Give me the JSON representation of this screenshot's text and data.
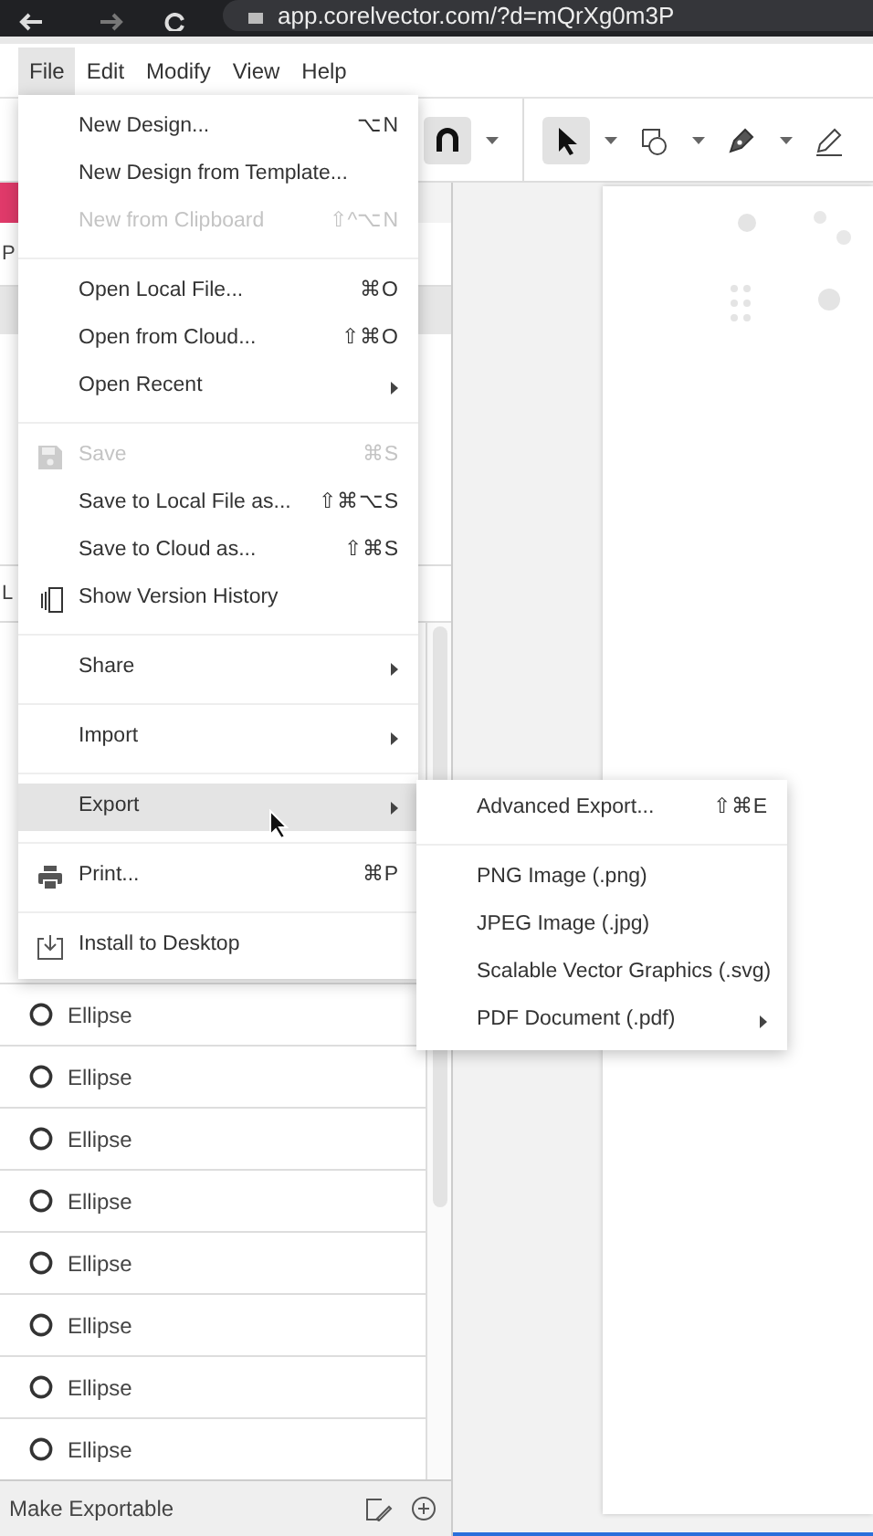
{
  "browser": {
    "url": "app.corelvector.com/?d=mQrXg0m3P"
  },
  "menubar": [
    {
      "label": "File",
      "selected": true
    },
    {
      "label": "Edit",
      "selected": false
    },
    {
      "label": "Modify",
      "selected": false
    },
    {
      "label": "View",
      "selected": false
    },
    {
      "label": "Help",
      "selected": false
    }
  ],
  "toolbar": [
    {
      "kind": "magnet",
      "selected": true,
      "dropdown": true
    },
    {
      "kind": "separator"
    },
    {
      "kind": "select",
      "selected": true,
      "dropdown": true
    },
    {
      "kind": "shapes",
      "selected": false,
      "dropdown": true
    },
    {
      "kind": "pen",
      "selected": false,
      "dropdown": true
    },
    {
      "kind": "pencil",
      "selected": false,
      "dropdown": false
    }
  ],
  "panels": [
    {
      "label": "P"
    },
    {
      "label": "L"
    }
  ],
  "file_menu": [
    {
      "kind": "item",
      "label": "New Design...",
      "shortcut": "⌥N",
      "disabled": false,
      "submenu": false,
      "selected": false
    },
    {
      "kind": "item",
      "label": "New Design from Template...",
      "disabled": false,
      "submenu": false,
      "selected": false
    },
    {
      "kind": "item",
      "label": "New from Clipboard",
      "shortcut": "⇧^⌥N",
      "disabled": true,
      "submenu": false,
      "selected": false
    },
    {
      "kind": "separator"
    },
    {
      "kind": "item",
      "label": "Open Local File...",
      "shortcut": "⌘O",
      "disabled": false,
      "submenu": false,
      "selected": false
    },
    {
      "kind": "item",
      "label": "Open from Cloud...",
      "shortcut": "⇧⌘O",
      "disabled": false,
      "submenu": false,
      "selected": false
    },
    {
      "kind": "item",
      "label": "Open Recent",
      "disabled": false,
      "submenu": true,
      "selected": false
    },
    {
      "kind": "separator"
    },
    {
      "kind": "save",
      "label": "Save",
      "shortcut": "⌘S",
      "disabled": true,
      "submenu": false,
      "selected": false
    },
    {
      "kind": "item",
      "label": "Save to Local File as...",
      "shortcut": "⇧⌘⌥S",
      "disabled": false,
      "submenu": false,
      "selected": false
    },
    {
      "kind": "item",
      "label": "Save to Cloud as...",
      "shortcut": "⇧⌘S",
      "disabled": false,
      "submenu": false,
      "selected": false
    },
    {
      "kind": "history",
      "label": "Show Version History",
      "disabled": false,
      "submenu": false,
      "selected": false
    },
    {
      "kind": "separator"
    },
    {
      "kind": "item",
      "label": "Share",
      "disabled": false,
      "submenu": true,
      "selected": false
    },
    {
      "kind": "separator"
    },
    {
      "kind": "item",
      "label": "Import",
      "disabled": false,
      "submenu": true,
      "selected": false
    },
    {
      "kind": "separator"
    },
    {
      "kind": "item",
      "label": "Export",
      "disabled": false,
      "submenu": true,
      "selected": true
    },
    {
      "kind": "separator"
    },
    {
      "kind": "print",
      "label": "Print...",
      "shortcut": "⌘P",
      "disabled": false,
      "submenu": false,
      "selected": false
    },
    {
      "kind": "separator"
    },
    {
      "kind": "install",
      "label": "Install to Desktop",
      "disabled": false,
      "submenu": false,
      "selected": false
    }
  ],
  "export_menu": [
    {
      "kind": "item",
      "label": "Advanced Export...",
      "shortcut": "⇧⌘E",
      "submenu": false
    },
    {
      "kind": "separator"
    },
    {
      "kind": "item",
      "label": "PNG Image (.png)",
      "submenu": false
    },
    {
      "kind": "item",
      "label": "JPEG Image (.jpg)",
      "submenu": false
    },
    {
      "kind": "item",
      "label": "Scalable Vector Graphics (.svg)",
      "submenu": false
    },
    {
      "kind": "item",
      "label": "PDF Document (.pdf)",
      "submenu": true
    }
  ],
  "layers": [
    {
      "label": "Ellipse"
    },
    {
      "label": "Ellipse"
    },
    {
      "label": "Ellipse"
    },
    {
      "label": "Ellipse"
    },
    {
      "label": "Ellipse"
    },
    {
      "label": "Ellipse"
    },
    {
      "label": "Ellipse"
    },
    {
      "label": "Ellipse"
    }
  ],
  "footer": {
    "label": "Make Exportable"
  }
}
